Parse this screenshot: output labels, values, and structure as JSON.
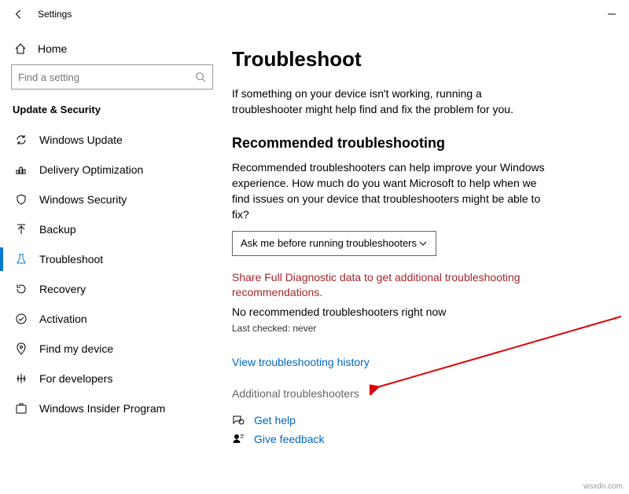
{
  "titlebar": {
    "title": "Settings"
  },
  "sidebar": {
    "home": "Home",
    "searchPlaceholder": "Find a setting",
    "sectionTitle": "Update & Security",
    "items": [
      {
        "label": "Windows Update"
      },
      {
        "label": "Delivery Optimization"
      },
      {
        "label": "Windows Security"
      },
      {
        "label": "Backup"
      },
      {
        "label": "Troubleshoot"
      },
      {
        "label": "Recovery"
      },
      {
        "label": "Activation"
      },
      {
        "label": "Find my device"
      },
      {
        "label": "For developers"
      },
      {
        "label": "Windows Insider Program"
      }
    ]
  },
  "main": {
    "heading": "Troubleshoot",
    "intro": "If something on your device isn't working, running a troubleshooter might help find and fix the problem for you.",
    "recTitle": "Recommended troubleshooting",
    "recBody": "Recommended troubleshooters can help improve your Windows experience. How much do you want Microsoft to help when we find issues on your device that troubleshooters might be able to fix?",
    "dropdownValue": "Ask me before running troubleshooters",
    "shareWarn": "Share Full Diagnostic data to get additional troubleshooting recommendations.",
    "noRec": "No recommended troubleshooters right now",
    "lastChecked": "Last checked: never",
    "historyLink": "View troubleshooting history",
    "additional": "Additional troubleshooters",
    "getHelp": "Get help",
    "feedback": "Give feedback"
  },
  "watermark": "wsxdn.com"
}
